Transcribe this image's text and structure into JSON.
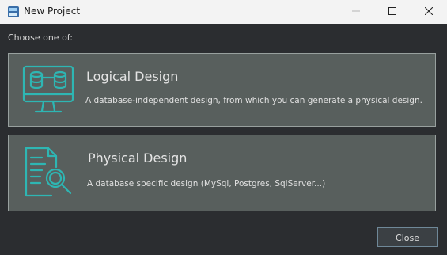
{
  "window": {
    "title": "New Project"
  },
  "prompt": "Choose one of:",
  "options": [
    {
      "title": "Logical Design",
      "description": "A database-independent design, from which you can generate a physical design.",
      "icon": "monitor-database-icon"
    },
    {
      "title": "Physical Design",
      "description": "A database specific design (MySql, Postgres, SqlServer...)",
      "icon": "document-search-icon"
    }
  ],
  "actions": {
    "close_label": "Close"
  },
  "colors": {
    "accent": "#2eb6b3",
    "card": "#585f5d",
    "background": "#2b2d30"
  }
}
